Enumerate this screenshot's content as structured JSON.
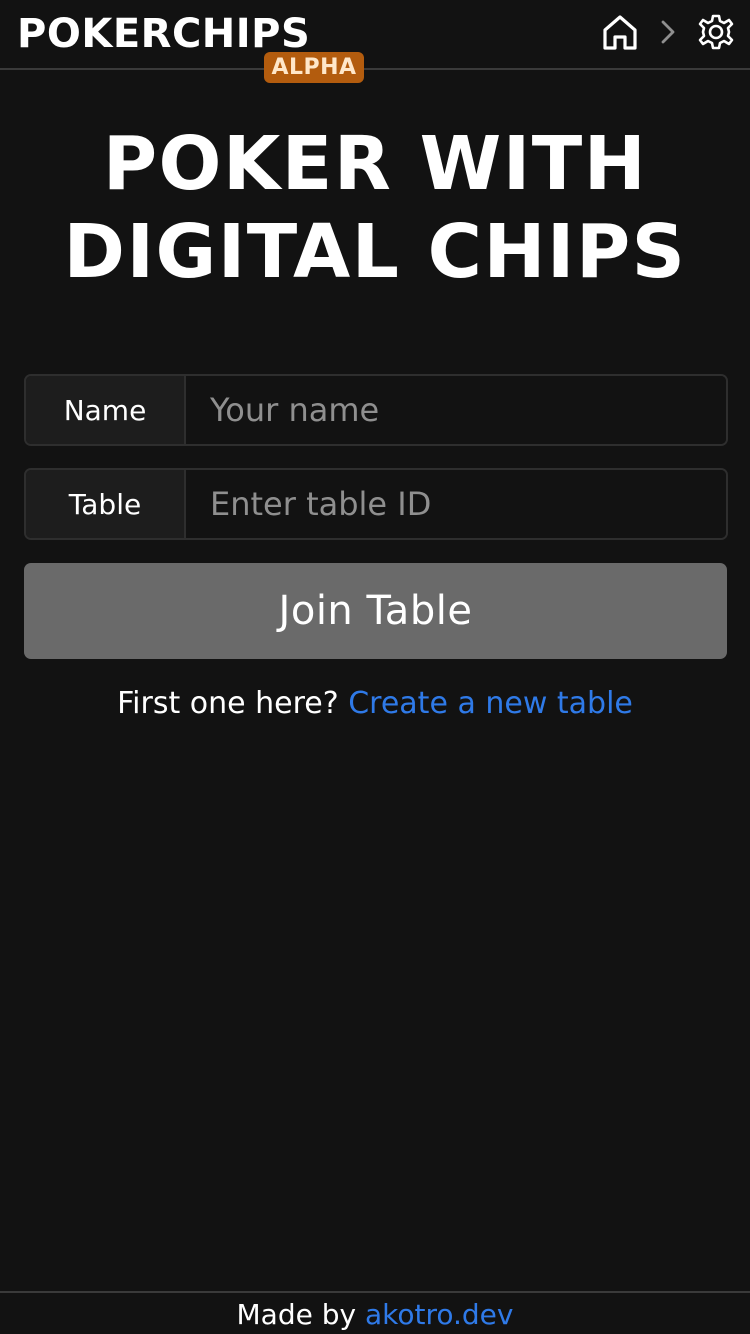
{
  "header": {
    "brand": "POKERCHIPS",
    "badge": "ALPHA",
    "home_icon": "home-icon",
    "separator_icon": "chevron-right-icon",
    "settings_icon": "gear-icon"
  },
  "hero": {
    "line1": "POKER WITH",
    "line2": "DIGITAL CHIPS"
  },
  "form": {
    "name_label": "Name",
    "name_placeholder": "Your name",
    "name_value": "",
    "table_label": "Table",
    "table_placeholder": "Enter table ID",
    "table_value": "",
    "join_label": "Join Table"
  },
  "create": {
    "prompt": "First one here?",
    "link_label": "Create a new table"
  },
  "footer": {
    "prefix": "Made by",
    "link_label": "akotro.dev"
  },
  "colors": {
    "background": "#121212",
    "badge": "#b35c0e",
    "button": "#6a6a6a",
    "link": "#2f7ae8"
  }
}
